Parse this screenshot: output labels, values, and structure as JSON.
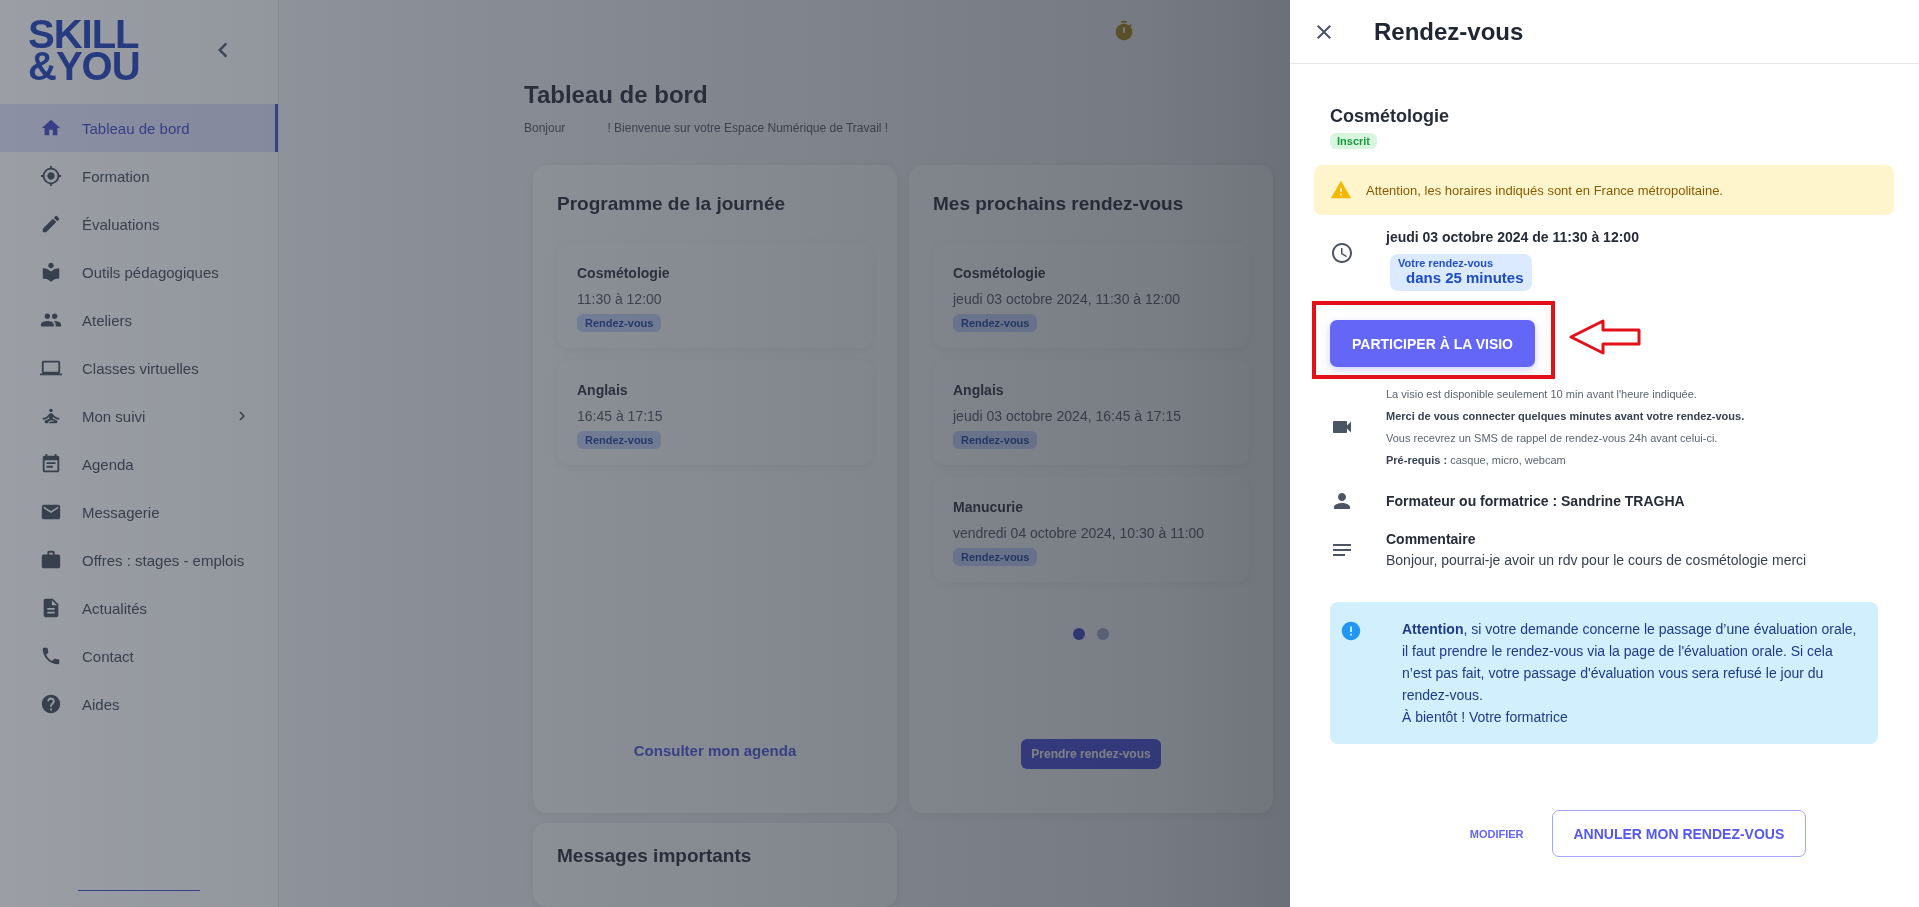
{
  "logo": {
    "lines": [
      "SKILL",
      "&YOU"
    ]
  },
  "sidebar": {
    "items": [
      {
        "label": "Tableau de bord",
        "selected": true,
        "submenu": false
      },
      {
        "label": "Formation",
        "selected": false,
        "submenu": false
      },
      {
        "label": "Évaluations",
        "selected": false,
        "submenu": false
      },
      {
        "label": "Outils pédagogiques",
        "selected": false,
        "submenu": false
      },
      {
        "label": "Ateliers",
        "selected": false,
        "submenu": false
      },
      {
        "label": "Classes virtuelles",
        "selected": false,
        "submenu": false
      },
      {
        "label": "Mon suivi",
        "selected": false,
        "submenu": true
      },
      {
        "label": "Agenda",
        "selected": false,
        "submenu": false
      },
      {
        "label": "Messagerie",
        "selected": false,
        "submenu": false
      },
      {
        "label": "Offres : stages - emplois",
        "selected": false,
        "submenu": false
      },
      {
        "label": "Actualités",
        "selected": false,
        "submenu": false
      },
      {
        "label": "Contact",
        "selected": false,
        "submenu": false
      },
      {
        "label": "Aides",
        "selected": false,
        "submenu": false
      }
    ]
  },
  "dashboard": {
    "title": "Tableau de bord",
    "greeting": "Bonjour",
    "welcome": "! Bienvenue sur votre Espace Numérique de Travail !",
    "program": {
      "title": "Programme de la journée",
      "items": [
        {
          "name": "Cosmétologie",
          "time": "11:30 à 12:00",
          "tag": "Rendez-vous"
        },
        {
          "name": "Anglais",
          "time": "16:45 à 17:15",
          "tag": "Rendez-vous"
        }
      ],
      "link": "Consulter mon agenda"
    },
    "upcoming": {
      "title": "Mes prochains rendez-vous",
      "items": [
        {
          "name": "Cosmétologie",
          "time": "jeudi 03 octobre 2024, 11:30 à 12:00",
          "tag": "Rendez-vous"
        },
        {
          "name": "Anglais",
          "time": "jeudi 03 octobre 2024, 16:45 à 17:15",
          "tag": "Rendez-vous"
        },
        {
          "name": "Manucurie",
          "time": "vendredi 04 octobre 2024, 10:30 à 11:00",
          "tag": "Rendez-vous"
        }
      ],
      "dots": [
        {
          "selected": true
        },
        {
          "selected": false
        }
      ],
      "button": "Prendre rendez-vous"
    },
    "messages": {
      "title": "Messages importants"
    }
  },
  "drawer": {
    "title": "Rendez-vous",
    "course": "Cosmétologie",
    "status": "Inscrit",
    "warning": "Attention, les horaires indiqués sont en France métropolitaine.",
    "date": "jeudi 03 octobre 2024 de 11:30 à 12:00",
    "countdown": {
      "label": "Votre rendez-vous",
      "value": "dans 25 minutes"
    },
    "join_button": "PARTICIPER À LA VISIO",
    "video_notes": [
      {
        "text": "La visio est disponible seulement 10 min avant l'heure indiquée.",
        "kind": "plain"
      },
      {
        "text": "Merci de vous connecter quelques minutes avant votre rendez-vous.",
        "kind": "strong"
      },
      {
        "text": "Vous recevrez un SMS de rappel de rendez-vous 24h avant celui-ci.",
        "kind": "plain"
      },
      {
        "text": "**Pré-requis :** casque, micro, webcam",
        "kind": "plain"
      }
    ],
    "trainer": "Formateur ou formatrice : Sandrine TRAGHA",
    "comment": {
      "label": "Commentaire",
      "text": "Bonjour, pourrai-je avoir un rdv pour le cours de cosmétologie merci"
    },
    "info": [
      "**Attention**, si votre demande concerne le passage d’une évaluation orale, il faut prendre le rendez-vous via la page de l'évaluation orale. Si cela n’est pas fait, votre passage d'évaluation vous sera refusé le jour du rendez-vous.",
      "À bientôt ! Votre formatrice"
    ],
    "buttons": {
      "modify": "MODIFIER",
      "cancel": "ANNULER MON RENDEZ-VOUS"
    }
  }
}
